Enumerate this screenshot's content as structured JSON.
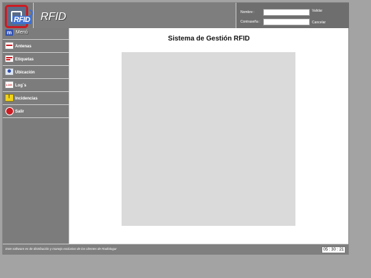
{
  "header": {
    "brand": "RFID",
    "logo_text": "RFID",
    "login": {
      "user_label": "Nombre :",
      "user_value": "",
      "pass_label": "Contraseña :",
      "pass_value": "",
      "validate": "Validar",
      "cancel": "Cancelar"
    }
  },
  "sidebar": {
    "menu_label": "Menú",
    "items": [
      {
        "label": "Antenas",
        "icon": "antenna-icon"
      },
      {
        "label": "Etiquetas",
        "icon": "tag-icon"
      },
      {
        "label": "Ubicación",
        "icon": "location-icon"
      },
      {
        "label": "Log´s",
        "icon": "log-icon"
      },
      {
        "label": "Incidencias",
        "icon": "warning-icon"
      },
      {
        "label": "Salir",
        "icon": "exit-icon"
      }
    ]
  },
  "main": {
    "title": "Sistema de Gestión RFID"
  },
  "footer": {
    "note": "Este software es de distribución y manejo exclusivo de los clientes de Radiologar",
    "clock": "05 : 30 : 21"
  },
  "colors": {
    "logo_border": "#cc1b22",
    "logo_blue": "#3d6fd0",
    "menu_icon": "#2f4fb0",
    "warning": "#f2d31b",
    "exit": "#cc1b22"
  }
}
